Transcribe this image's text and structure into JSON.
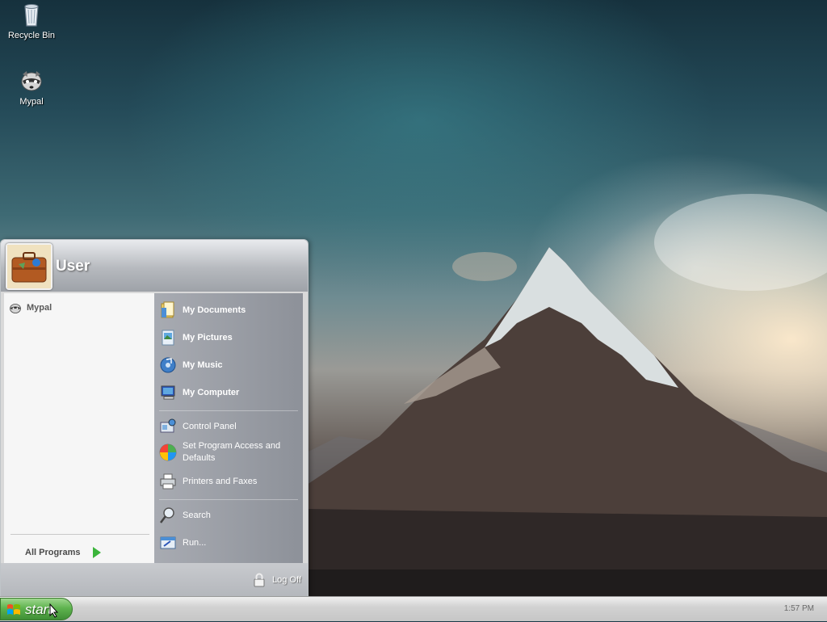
{
  "desktop": {
    "icons": [
      {
        "label": "Recycle Bin",
        "icon": "recycle-bin-icon"
      },
      {
        "label": "Mypal",
        "icon": "mypal-raccoon-icon"
      }
    ]
  },
  "start_menu": {
    "user_name": "User",
    "user_picture_icon": "briefcase-icon",
    "pinned": [
      {
        "label": "Mypal",
        "icon": "mypal-raccoon-icon"
      }
    ],
    "all_programs_label": "All Programs",
    "right_items": [
      {
        "label": "My Documents",
        "icon": "my-documents-icon"
      },
      {
        "label": "My Pictures",
        "icon": "my-pictures-icon"
      },
      {
        "label": "My Music",
        "icon": "my-music-icon"
      },
      {
        "label": "My Computer",
        "icon": "my-computer-icon"
      },
      {
        "label": "Control Panel",
        "icon": "control-panel-icon"
      },
      {
        "label": "Set Program Access and Defaults",
        "icon": "program-defaults-icon"
      },
      {
        "label": "Printers and Faxes",
        "icon": "printer-icon"
      },
      {
        "label": "Search",
        "icon": "search-icon"
      },
      {
        "label": "Run...",
        "icon": "run-icon"
      }
    ],
    "log_off_label": "Log Off"
  },
  "taskbar": {
    "start_label": "start",
    "clock": "1:57 PM"
  },
  "colors": {
    "start_green": "#4da43d",
    "menu_right_panel": "#9a9ea5",
    "menu_left_panel": "#f6f6f6"
  }
}
